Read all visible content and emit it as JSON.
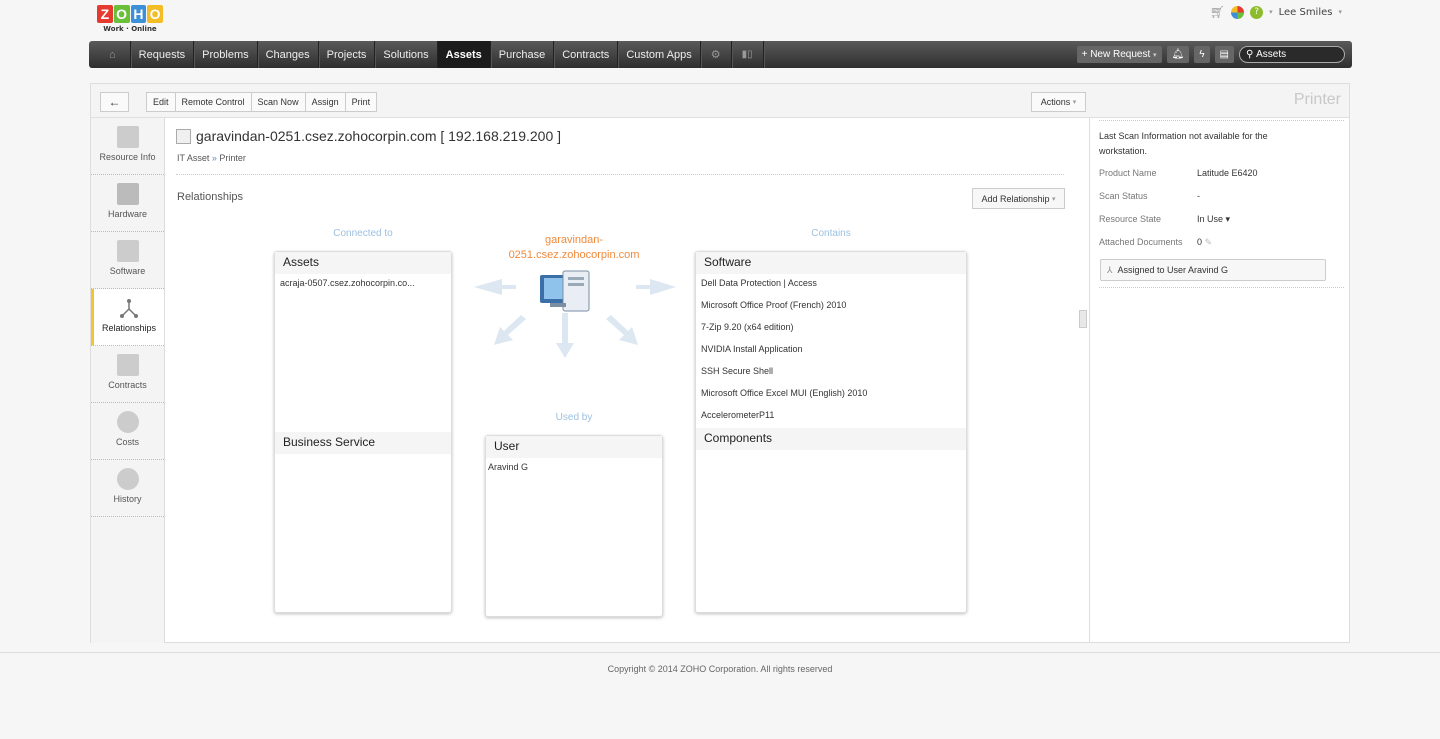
{
  "logo": {
    "letters": [
      "Z",
      "O",
      "H",
      "O"
    ],
    "colors": [
      "#e63a2e",
      "#6abf3b",
      "#3d8fd7",
      "#f3bd26"
    ],
    "tagline": "Work · Online"
  },
  "topbar": {
    "user_name": "Lee Smiles",
    "icons": [
      "cart-icon",
      "apps-icon",
      "help-icon"
    ]
  },
  "nav": {
    "items": [
      {
        "label": "Requests"
      },
      {
        "label": "Problems"
      },
      {
        "label": "Changes"
      },
      {
        "label": "Projects"
      },
      {
        "label": "Solutions"
      },
      {
        "label": "Assets",
        "active": true
      },
      {
        "label": "Purchase"
      },
      {
        "label": "Contracts"
      },
      {
        "label": "Custom Apps"
      }
    ],
    "new_request": "+ New Request",
    "search_scope": "Assets"
  },
  "toolbar": {
    "buttons": [
      "Edit",
      "Remote Control",
      "Scan Now",
      "Assign",
      "Print"
    ],
    "actions": "Actions",
    "page_type": "Printer"
  },
  "left_tabs": [
    {
      "label": "Resource Info",
      "icon": "resource-info-icon"
    },
    {
      "label": "Hardware",
      "icon": "hardware-icon"
    },
    {
      "label": "Software",
      "icon": "software-icon"
    },
    {
      "label": "Relationships",
      "icon": "relationships-icon",
      "active": true
    },
    {
      "label": "Contracts",
      "icon": "contracts-icon"
    },
    {
      "label": "Costs",
      "icon": "costs-icon"
    },
    {
      "label": "History",
      "icon": "history-icon"
    }
  ],
  "asset": {
    "title": "garavindan-0251.csez.zohocorpin.com [ 192.168.219.200 ]",
    "breadcrumb": [
      "IT Asset",
      "Printer"
    ],
    "breadcrumb_sep": "»",
    "center_name_line1": "garavindan-",
    "center_name_line2": "0251.csez.zohocorpin.com"
  },
  "relationships": {
    "heading": "Relationships",
    "add_button": "Add Relationship",
    "connected_label": "Connected to",
    "contains_label": "Contains",
    "used_by_label": "Used by",
    "assets": {
      "title": "Assets",
      "items": [
        "acraja-0507.csez.zohocorpin.co..."
      ]
    },
    "business_service": {
      "title": "Business Service",
      "items": []
    },
    "user": {
      "title": "User",
      "items": [
        "Aravind G"
      ]
    },
    "software": {
      "title": "Software",
      "items": [
        "Dell Data Protection | Access",
        "Microsoft Office Proof (French) 2010",
        "7-Zip 9.20 (x64 edition)",
        "NVIDIA Install Application",
        "SSH Secure Shell",
        "Microsoft Office Excel MUI (English) 2010",
        "AccelerometerP11"
      ]
    },
    "components": {
      "title": "Components",
      "items": []
    }
  },
  "right_panel": {
    "scan_info": "Last Scan Information not available for the workstation.",
    "fields": [
      {
        "label": "Product Name",
        "value": "Latitude E6420"
      },
      {
        "label": "Scan Status",
        "value": "-"
      },
      {
        "label": "Resource State",
        "value": "In Use ▾"
      },
      {
        "label": "Attached Documents",
        "value": "0"
      }
    ],
    "assigned": "Assigned to User Aravind G"
  },
  "footer": {
    "copyright": "Copyright © 2014 ZOHO Corporation. All rights reserved"
  }
}
